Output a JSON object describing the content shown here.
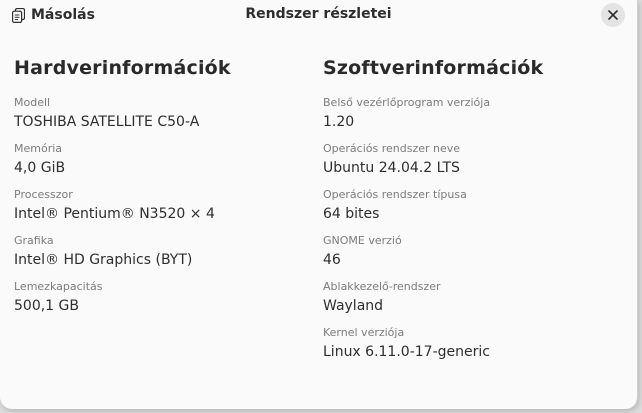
{
  "header": {
    "copy_label": "Másolás",
    "title": "Rendszer részletei"
  },
  "hardware": {
    "title": "Hardverinformációk",
    "fields": [
      {
        "label": "Modell",
        "value": "TOSHIBA SATELLITE C50-A"
      },
      {
        "label": "Memória",
        "value": "4,0 GiB"
      },
      {
        "label": "Processzor",
        "value": "Intel® Pentium® N3520 × 4"
      },
      {
        "label": "Grafika",
        "value": "Intel® HD Graphics (BYT)"
      },
      {
        "label": "Lemezkapacitás",
        "value": "500,1 GB"
      }
    ]
  },
  "software": {
    "title": "Szoftverinformációk",
    "fields": [
      {
        "label": "Belső vezérlőprogram verziója",
        "value": "1.20"
      },
      {
        "label": "Operációs rendszer neve",
        "value": "Ubuntu 24.04.2 LTS"
      },
      {
        "label": "Operációs rendszer típusa",
        "value": "64 bites"
      },
      {
        "label": "GNOME verzió",
        "value": "46"
      },
      {
        "label": "Ablakkezelő-rendszer",
        "value": "Wayland"
      },
      {
        "label": "Kernel verziója",
        "value": "Linux 6.11.0-17-generic"
      }
    ]
  },
  "icons": {
    "copy": "copy-icon",
    "close": "close-icon"
  },
  "colors": {
    "dialog_bg": "#fafafa",
    "text": "#2e2e2e",
    "label": "#7c7c7c",
    "close_bg": "#e4e4e4"
  }
}
